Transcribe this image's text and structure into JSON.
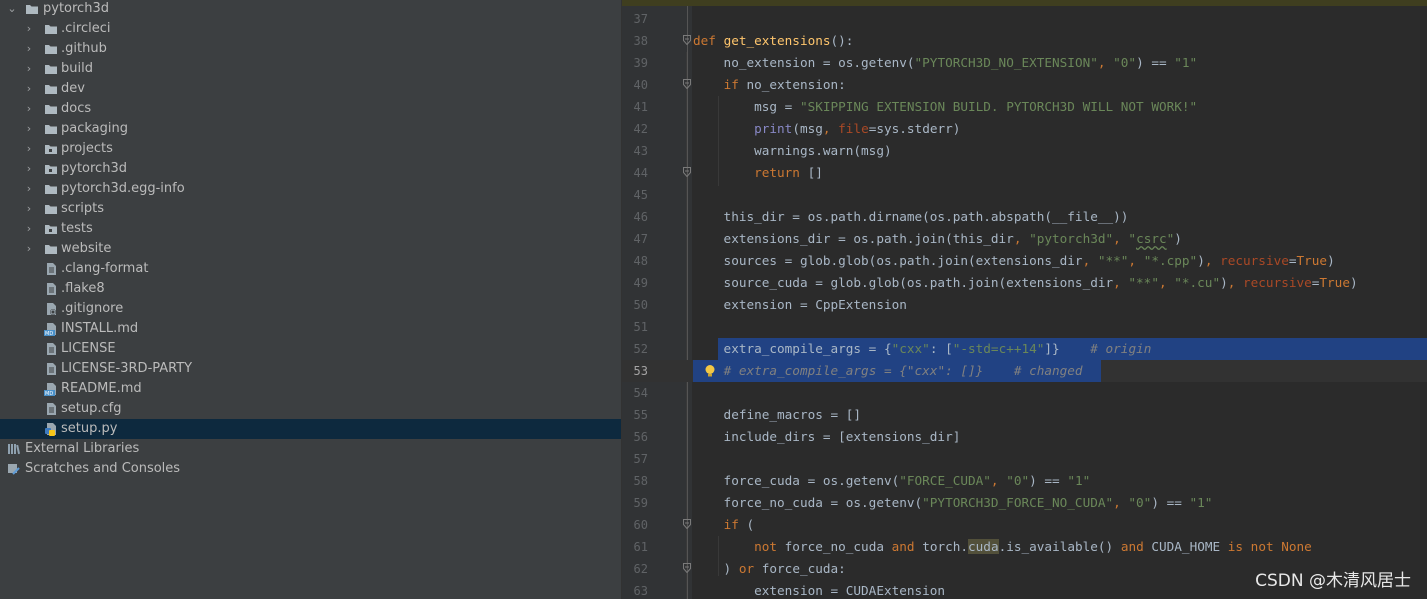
{
  "project_tree": {
    "root": {
      "label": "pytorch3d",
      "icon": "folder-icon",
      "expanded": true
    },
    "items": [
      {
        "label": ".circleci",
        "icon": "folder-icon",
        "kind": "folder"
      },
      {
        "label": ".github",
        "icon": "folder-icon",
        "kind": "folder"
      },
      {
        "label": "build",
        "icon": "folder-icon",
        "kind": "folder"
      },
      {
        "label": "dev",
        "icon": "folder-icon",
        "kind": "folder"
      },
      {
        "label": "docs",
        "icon": "folder-icon",
        "kind": "folder"
      },
      {
        "label": "packaging",
        "icon": "folder-icon",
        "kind": "folder"
      },
      {
        "label": "projects",
        "icon": "package-folder-icon",
        "kind": "folder"
      },
      {
        "label": "pytorch3d",
        "icon": "package-folder-icon",
        "kind": "folder"
      },
      {
        "label": "pytorch3d.egg-info",
        "icon": "folder-icon",
        "kind": "folder"
      },
      {
        "label": "scripts",
        "icon": "folder-icon",
        "kind": "folder"
      },
      {
        "label": "tests",
        "icon": "package-folder-icon",
        "kind": "folder"
      },
      {
        "label": "website",
        "icon": "folder-icon",
        "kind": "folder"
      },
      {
        "label": ".clang-format",
        "icon": "text-file-icon",
        "kind": "file"
      },
      {
        "label": ".flake8",
        "icon": "text-file-icon",
        "kind": "file"
      },
      {
        "label": ".gitignore",
        "icon": "ignore-file-icon",
        "kind": "file"
      },
      {
        "label": "INSTALL.md",
        "icon": "markdown-file-icon",
        "kind": "file"
      },
      {
        "label": "LICENSE",
        "icon": "text-file-icon",
        "kind": "file"
      },
      {
        "label": "LICENSE-3RD-PARTY",
        "icon": "text-file-icon",
        "kind": "file"
      },
      {
        "label": "README.md",
        "icon": "markdown-file-icon",
        "kind": "file"
      },
      {
        "label": "setup.cfg",
        "icon": "text-file-icon",
        "kind": "file"
      },
      {
        "label": "setup.py",
        "icon": "python-file-icon",
        "kind": "file",
        "selected": true
      }
    ],
    "external_libraries": {
      "label": "External Libraries",
      "icon": "libraries-icon"
    },
    "scratches": {
      "label": "Scratches and Consoles",
      "icon": "scratches-icon"
    }
  },
  "editor": {
    "current_line": 53,
    "lines": [
      {
        "n": "37",
        "tokens": []
      },
      {
        "n": "38",
        "fold": true,
        "tokens": [
          [
            "kw",
            "def "
          ],
          [
            "fn",
            "get_extensions"
          ],
          [
            "tx",
            "():"
          ]
        ]
      },
      {
        "n": "39",
        "tokens": [
          [
            "tx",
            "    no_extension = os.getenv("
          ],
          [
            "st",
            "\"PYTORCH3D_NO_EXTENSION\""
          ],
          [
            "kw",
            ", "
          ],
          [
            "st",
            "\"0\""
          ],
          [
            "tx",
            ") == "
          ],
          [
            "st",
            "\"1\""
          ]
        ]
      },
      {
        "n": "40",
        "fold": true,
        "tokens": [
          [
            "tx",
            "    "
          ],
          [
            "kw",
            "if "
          ],
          [
            "tx",
            "no_extension:"
          ]
        ]
      },
      {
        "n": "41",
        "tokens": [
          [
            "tx",
            "        msg = "
          ],
          [
            "st",
            "\"SKIPPING EXTENSION BUILD. PYTORCH3D WILL NOT WORK!\""
          ]
        ]
      },
      {
        "n": "42",
        "tokens": [
          [
            "tx",
            "        "
          ],
          [
            "bi",
            "print"
          ],
          [
            "tx",
            "(msg"
          ],
          [
            "kw",
            ", "
          ],
          [
            "pm",
            "file"
          ],
          [
            "tx",
            "=sys.stderr)"
          ]
        ]
      },
      {
        "n": "43",
        "tokens": [
          [
            "tx",
            "        warnings.warn(msg)"
          ]
        ]
      },
      {
        "n": "44",
        "fold": true,
        "tokens": [
          [
            "tx",
            "        "
          ],
          [
            "kw",
            "return "
          ],
          [
            "tx",
            "[]"
          ]
        ]
      },
      {
        "n": "45",
        "tokens": []
      },
      {
        "n": "46",
        "tokens": [
          [
            "tx",
            "    this_dir = os.path.dirname(os.path.abspath(__file__))"
          ]
        ]
      },
      {
        "n": "47",
        "tokens": [
          [
            "tx",
            "    extensions_dir = os.path.join(this_dir"
          ],
          [
            "kw",
            ", "
          ],
          [
            "st",
            "\"pytorch3d\""
          ],
          [
            "kw",
            ", "
          ],
          [
            "st",
            "\""
          ],
          [
            "stw",
            "csrc"
          ],
          [
            "st",
            "\""
          ],
          [
            "tx",
            ")"
          ]
        ]
      },
      {
        "n": "48",
        "tokens": [
          [
            "tx",
            "    sources = glob.glob(os.path.join(extensions_dir"
          ],
          [
            "kw",
            ", "
          ],
          [
            "st",
            "\"**\""
          ],
          [
            "kw",
            ", "
          ],
          [
            "st",
            "\"*.cpp\""
          ],
          [
            "tx",
            ")"
          ],
          [
            "kw",
            ", "
          ],
          [
            "pm",
            "recursive"
          ],
          [
            "tx",
            "="
          ],
          [
            "kw",
            "True"
          ],
          [
            "tx",
            ")"
          ]
        ]
      },
      {
        "n": "49",
        "tokens": [
          [
            "tx",
            "    source_cuda = glob.glob(os.path.join(extensions_dir"
          ],
          [
            "kw",
            ", "
          ],
          [
            "st",
            "\"**\""
          ],
          [
            "kw",
            ", "
          ],
          [
            "st",
            "\"*.cu\""
          ],
          [
            "tx",
            ")"
          ],
          [
            "kw",
            ", "
          ],
          [
            "pm",
            "recursive"
          ],
          [
            "tx",
            "="
          ],
          [
            "kw",
            "True"
          ],
          [
            "tx",
            ")"
          ]
        ]
      },
      {
        "n": "50",
        "tokens": [
          [
            "tx",
            "    extension = CppExtension"
          ]
        ]
      },
      {
        "n": "51",
        "tokens": []
      },
      {
        "n": "52",
        "sel": "line",
        "tokens": [
          [
            "tx",
            "    extra_compile_args = {"
          ],
          [
            "st",
            "\"cxx\""
          ],
          [
            "tx",
            ": ["
          ],
          [
            "st",
            "\"-std=c++14\""
          ],
          [
            "tx",
            "]}    "
          ],
          [
            "cm",
            "# origin"
          ]
        ]
      },
      {
        "n": "53",
        "sel": "partial",
        "bulb": true,
        "tokens": [
          [
            "tx",
            "    "
          ],
          [
            "cm",
            "# extra_compile_args = {\"cxx\": []}    # changed"
          ]
        ]
      },
      {
        "n": "54",
        "tokens": []
      },
      {
        "n": "55",
        "tokens": [
          [
            "tx",
            "    define_macros = []"
          ]
        ]
      },
      {
        "n": "56",
        "tokens": [
          [
            "tx",
            "    include_dirs = [extensions_dir]"
          ]
        ]
      },
      {
        "n": "57",
        "tokens": []
      },
      {
        "n": "58",
        "tokens": [
          [
            "tx",
            "    force_cuda = os.getenv("
          ],
          [
            "st",
            "\"FORCE_CUDA\""
          ],
          [
            "kw",
            ", "
          ],
          [
            "st",
            "\"0\""
          ],
          [
            "tx",
            ") == "
          ],
          [
            "st",
            "\"1\""
          ]
        ]
      },
      {
        "n": "59",
        "tokens": [
          [
            "tx",
            "    force_no_cuda = os.getenv("
          ],
          [
            "st",
            "\"PYTORCH3D_FORCE_NO_CUDA\""
          ],
          [
            "kw",
            ", "
          ],
          [
            "st",
            "\"0\""
          ],
          [
            "tx",
            ") == "
          ],
          [
            "st",
            "\"1\""
          ]
        ]
      },
      {
        "n": "60",
        "fold": true,
        "tokens": [
          [
            "tx",
            "    "
          ],
          [
            "kw",
            "if "
          ],
          [
            "tx",
            "("
          ]
        ]
      },
      {
        "n": "61",
        "tokens": [
          [
            "tx",
            "        "
          ],
          [
            "kw",
            "not "
          ],
          [
            "tx",
            "force_no_cuda "
          ],
          [
            "kw",
            "and "
          ],
          [
            "tx",
            "torch."
          ],
          [
            "hl",
            "cuda"
          ],
          [
            "tx",
            ".is_available() "
          ],
          [
            "kw",
            "and "
          ],
          [
            "tx",
            "CUDA_HOME "
          ],
          [
            "kw",
            "is not None"
          ]
        ]
      },
      {
        "n": "62",
        "fold": true,
        "tokens": [
          [
            "tx",
            "    ) "
          ],
          [
            "kw",
            "or "
          ],
          [
            "tx",
            "force_cuda:"
          ]
        ]
      },
      {
        "n": "63",
        "tokens": [
          [
            "tx",
            "        extension = CUDAExtension"
          ]
        ]
      }
    ]
  },
  "colors": {
    "sidebar_bg": "#3c3f41",
    "editor_bg": "#2b2b2b",
    "selection": "#214283",
    "keyword": "#cc7832",
    "string": "#6a8759",
    "comment": "#808080"
  },
  "watermark": "CSDN @木清风居士"
}
